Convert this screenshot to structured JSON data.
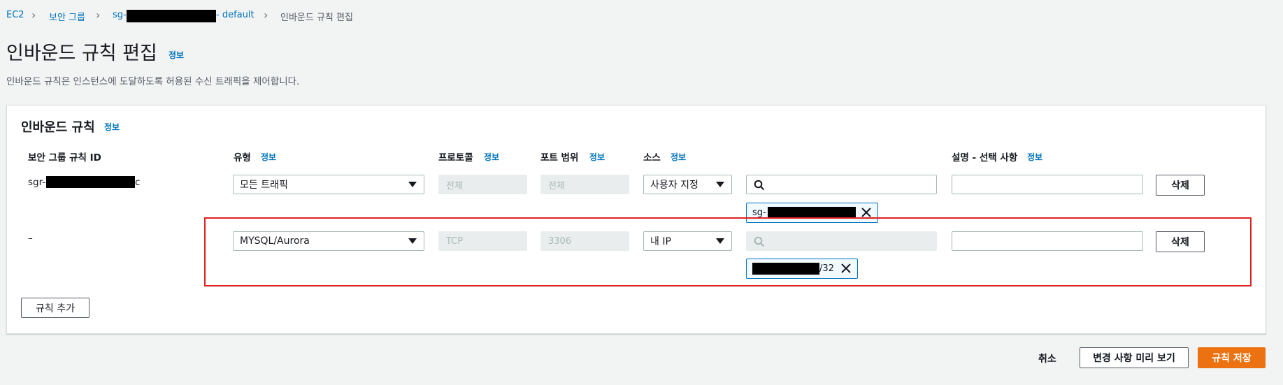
{
  "breadcrumb": {
    "ec2": "EC2",
    "security_groups": "보안 그룹",
    "sg_prefix": "sg-",
    "sg_suffix": "- default",
    "current": "인바운드 규칙 편집"
  },
  "page": {
    "title": "인바운드 규칙 편집",
    "info": "정보",
    "description": "인바운드 규칙은 인스턴스에 도달하도록 허용된 수신 트래픽을 제어합니다."
  },
  "panel": {
    "title": "인바운드 규칙",
    "info": "정보"
  },
  "columns": {
    "rule_id": "보안 그룹 규칙 ID",
    "type": "유형",
    "protocol": "프로토콜",
    "port_range": "포트 범위",
    "source": "소스",
    "description": "설명 - 선택 사항",
    "info": "정보"
  },
  "rows": [
    {
      "rule_id_prefix": "sgr-",
      "rule_id_suffix": "c",
      "type": "모든 트래픽",
      "protocol": "전체",
      "port": "전체",
      "source": "사용자 지정",
      "token_prefix": "sg-",
      "delete": "삭제"
    },
    {
      "rule_id": "–",
      "type": "MYSQL/Aurora",
      "protocol": "TCP",
      "port": "3306",
      "source": "내 IP",
      "token_suffix": "/32",
      "delete": "삭제"
    }
  ],
  "actions": {
    "add_rule": "규칙 추가",
    "cancel": "취소",
    "preview": "변경 사항 미리 보기",
    "save": "규칙 저장"
  },
  "colors": {
    "link": "#0073bb",
    "primary": "#ec7211",
    "highlight": "#e02020"
  }
}
